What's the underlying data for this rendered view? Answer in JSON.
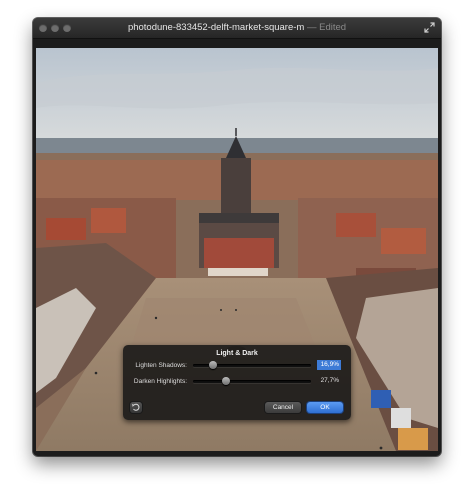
{
  "window": {
    "title": "photodune-833452-delft-market-square-m",
    "separator": " — ",
    "status": "Edited"
  },
  "icons": {
    "traffic_lights": [
      "close-button",
      "minimize-button",
      "zoom-button"
    ],
    "fullscreen": "fullscreen-arrows-icon",
    "reset": "reset-arrow-icon"
  },
  "hud": {
    "title": "Light & Dark",
    "rows": [
      {
        "label": "Lighten Shadows:",
        "value": "16,9%",
        "level": 0.169,
        "selected": true
      },
      {
        "label": "Darken Highlights:",
        "value": "27,7%",
        "level": 0.277,
        "selected": false
      }
    ],
    "cancel_label": "Cancel",
    "ok_label": "OK"
  },
  "colors": {
    "accent": "#3d7bd6",
    "hud_bg": "#141414"
  }
}
